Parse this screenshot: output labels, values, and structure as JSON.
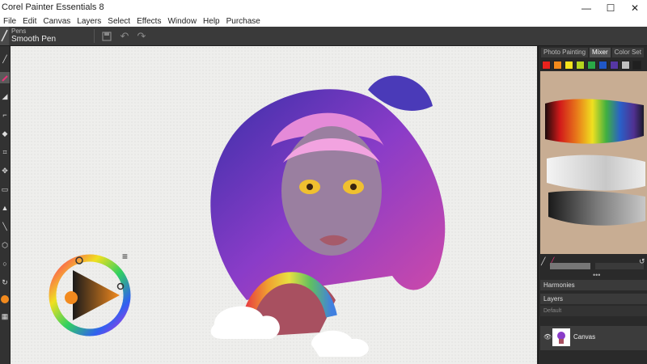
{
  "window": {
    "title": "Corel Painter Essentials 8",
    "controls": [
      "—",
      "☐",
      "✕"
    ]
  },
  "menu": [
    "File",
    "Edit",
    "Canvas",
    "Layers",
    "Select",
    "Effects",
    "Window",
    "Help",
    "Purchase"
  ],
  "brush": {
    "category": "Pens",
    "variant": "Smooth Pen"
  },
  "panel": {
    "tabs": [
      "Photo Painting",
      "Mixer",
      "Color Set"
    ],
    "active_tab": "Mixer",
    "swatches": [
      "#e8221d",
      "#f38a1c",
      "#f5e31d",
      "#b5d51e",
      "#2aa846",
      "#2057c6",
      "#5637a3",
      "#c0c0c0",
      "#202020"
    ],
    "harmonies_label": "Harmonies",
    "layers_label": "Layers",
    "layer_mode": "Default",
    "layers": [
      {
        "name": "Canvas"
      }
    ]
  },
  "color_wheel": {
    "selected_color": "#f28a1e",
    "hue_marker_color": "#e78a24"
  },
  "colors": {
    "canvas_bg": "#eeeeec",
    "ui_dark": "#2b2b2b",
    "accent_orange": "#f28a1e",
    "mixer_bg": "#c8ad93"
  }
}
